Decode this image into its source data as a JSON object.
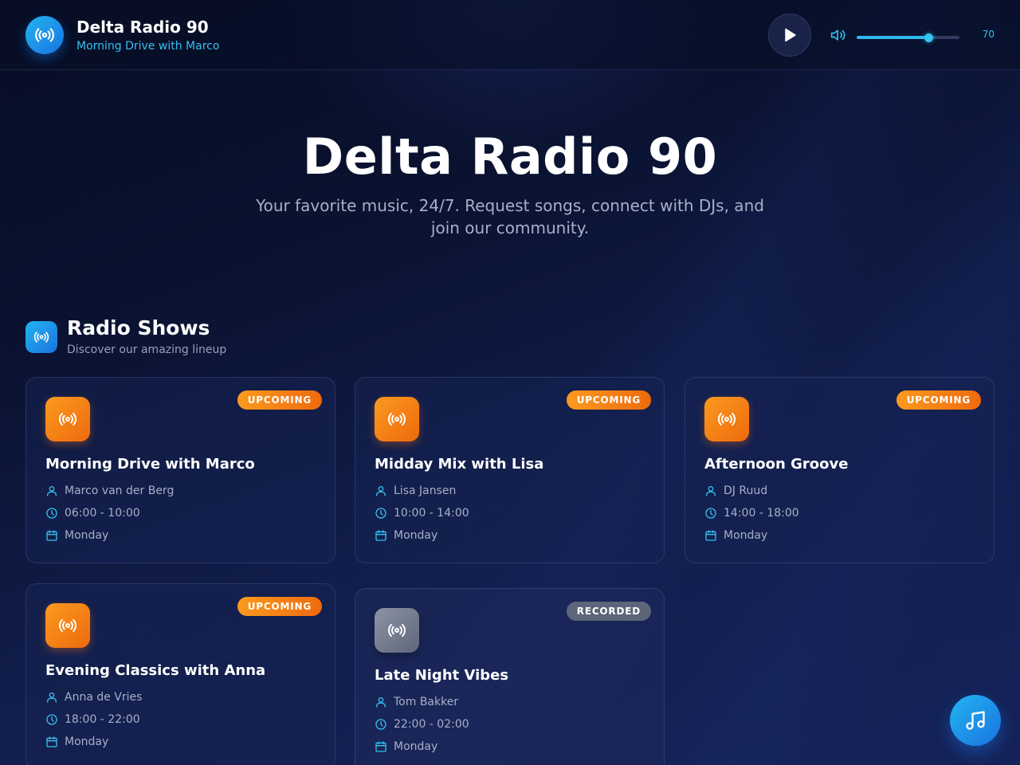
{
  "header": {
    "station_name": "Delta Radio 90",
    "now_playing": "Morning Drive with Marco",
    "logo_icon": "radio-broadcast-icon",
    "play_icon": "play-icon",
    "volume_icon": "volume-icon",
    "volume": 70,
    "volume_label": "70"
  },
  "hero": {
    "title": "Delta Radio 90",
    "subtitle": "Your favorite music, 24/7. Request songs, connect with DJs, and join our community."
  },
  "section": {
    "icon": "radio-broadcast-icon",
    "title": "Radio Shows",
    "subtitle": "Discover our amazing lineup"
  },
  "shows": [
    {
      "title": "Morning Drive with Marco",
      "host": "Marco van der Berg",
      "time": "06:00 - 10:00",
      "day": "Monday",
      "status": "UPCOMING"
    },
    {
      "title": "Midday Mix with Lisa",
      "host": "Lisa Jansen",
      "time": "10:00 - 14:00",
      "day": "Monday",
      "status": "UPCOMING"
    },
    {
      "title": "Afternoon Groove",
      "host": "DJ Ruud",
      "time": "14:00 - 18:00",
      "day": "Monday",
      "status": "UPCOMING"
    },
    {
      "title": "Evening Classics with Anna",
      "host": "Anna de Vries",
      "time": "18:00 - 22:00",
      "day": "Monday",
      "status": "UPCOMING"
    },
    {
      "title": "Late Night Vibes",
      "host": "Tom Bakker",
      "time": "22:00 - 02:00",
      "day": "Monday",
      "status": "RECORDED"
    }
  ],
  "fab": {
    "icon": "music-note-icon"
  },
  "colors": {
    "accent": "#2fb8ee",
    "upcoming": "#f58516",
    "recorded": "#5d6579",
    "background": "#0a1230"
  }
}
